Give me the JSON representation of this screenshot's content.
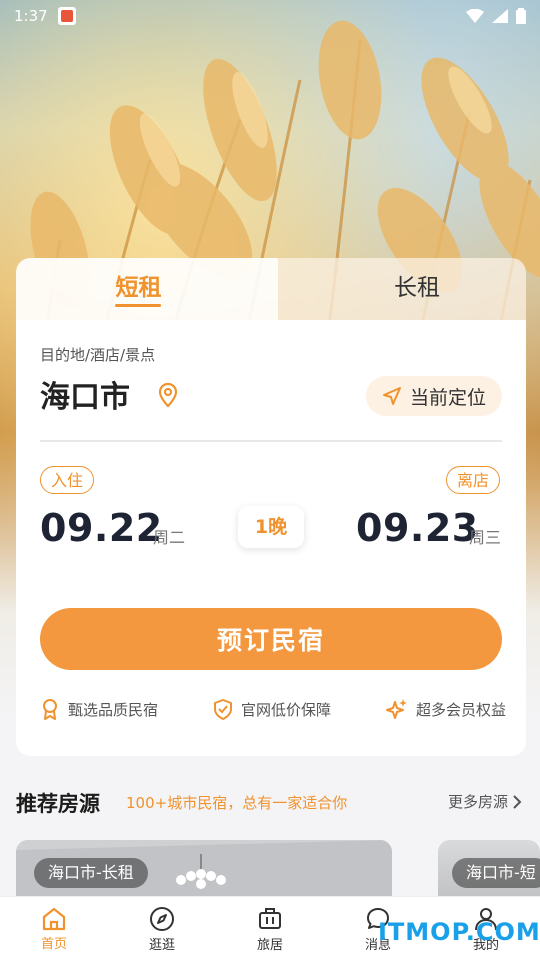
{
  "status_bar": {
    "time": "1:37"
  },
  "tabs": {
    "short_rent": "短租",
    "long_rent": "长租"
  },
  "destination": {
    "label": "目的地/酒店/景点",
    "city": "海口市",
    "locate_label": "当前定位"
  },
  "dates": {
    "check_in_label": "入住",
    "check_in_date": "09.22",
    "check_in_weekday": "周二",
    "nights": "1晚",
    "check_out_label": "离店",
    "check_out_date": "09.23",
    "check_out_weekday": "周三"
  },
  "book_button": "预订民宿",
  "perks": [
    "甄选品质民宿",
    "官网低价保障",
    "超多会员权益"
  ],
  "recommend": {
    "title": "推荐房源",
    "subtitle": "100+城市民宿，总有一家适合你",
    "more": "更多房源",
    "listings": [
      {
        "tag": "海口市-长租"
      },
      {
        "tag": "海口市-短"
      }
    ]
  },
  "nav": {
    "items": [
      "首页",
      "逛逛",
      "旅居",
      "消息",
      "我的"
    ]
  },
  "watermark": "ITMOP.COM",
  "colors": {
    "accent": "#f0922d",
    "button": "#f3983e"
  }
}
